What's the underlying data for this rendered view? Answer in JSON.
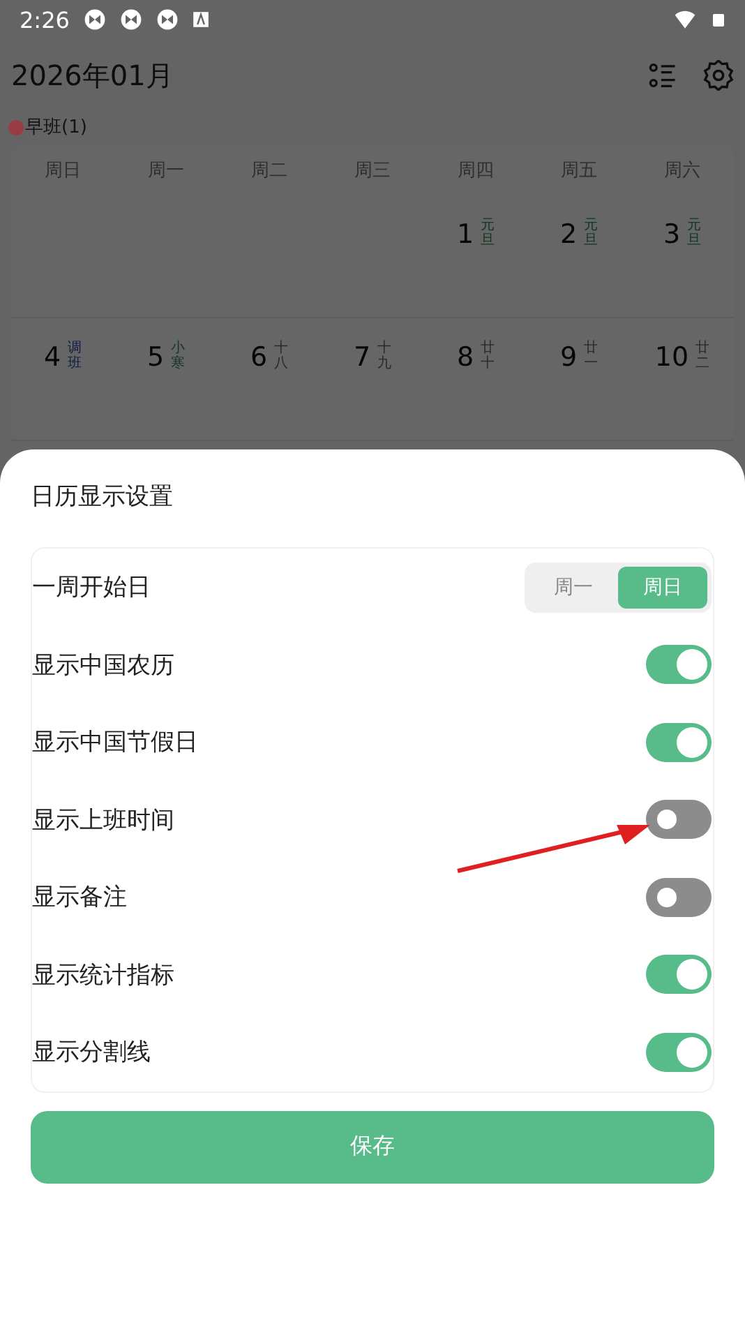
{
  "status_bar": {
    "time": "2:26"
  },
  "header": {
    "title": "2026年01月"
  },
  "legend": [
    {
      "label": "早班(1)",
      "color": "#9a3c44"
    }
  ],
  "calendar": {
    "weekdays": [
      "周日",
      "周一",
      "周二",
      "周三",
      "周四",
      "周五",
      "周六"
    ],
    "weeks": [
      [
        {
          "kind": "blank"
        },
        {
          "kind": "blank"
        },
        {
          "kind": "blank"
        },
        {
          "kind": "blank"
        },
        {
          "day": "1",
          "note": "元旦",
          "kind": "holiday"
        },
        {
          "day": "2",
          "note": "元旦",
          "kind": "holiday"
        },
        {
          "day": "3",
          "note": "元旦",
          "kind": "holiday"
        }
      ],
      [
        {
          "day": "4",
          "note": "调班",
          "kind": "workday"
        },
        {
          "day": "5",
          "note": "小寒",
          "kind": "term"
        },
        {
          "day": "6",
          "note": "十八",
          "kind": "lunar"
        },
        {
          "day": "7",
          "note": "十九",
          "kind": "lunar"
        },
        {
          "day": "8",
          "note": "廿十",
          "kind": "lunar"
        },
        {
          "day": "9",
          "note": "廿一",
          "kind": "lunar"
        },
        {
          "day": "10",
          "note": "廿二",
          "kind": "lunar"
        }
      ]
    ]
  },
  "sheet": {
    "title": "日历显示设置",
    "settings": [
      {
        "kind": "segmented",
        "label": "一周开始日",
        "options": [
          {
            "label": "周一",
            "selected": false
          },
          {
            "label": "周日",
            "selected": true
          }
        ]
      },
      {
        "kind": "toggle",
        "label": "显示中国农历",
        "on": true
      },
      {
        "kind": "toggle",
        "label": "显示中国节假日",
        "on": true
      },
      {
        "kind": "toggle",
        "label": "显示上班时间",
        "on": false
      },
      {
        "kind": "toggle",
        "label": "显示备注",
        "on": false
      },
      {
        "kind": "toggle",
        "label": "显示统计指标",
        "on": true
      },
      {
        "kind": "toggle",
        "label": "显示分割线",
        "on": true
      }
    ],
    "save_button": "保存"
  }
}
